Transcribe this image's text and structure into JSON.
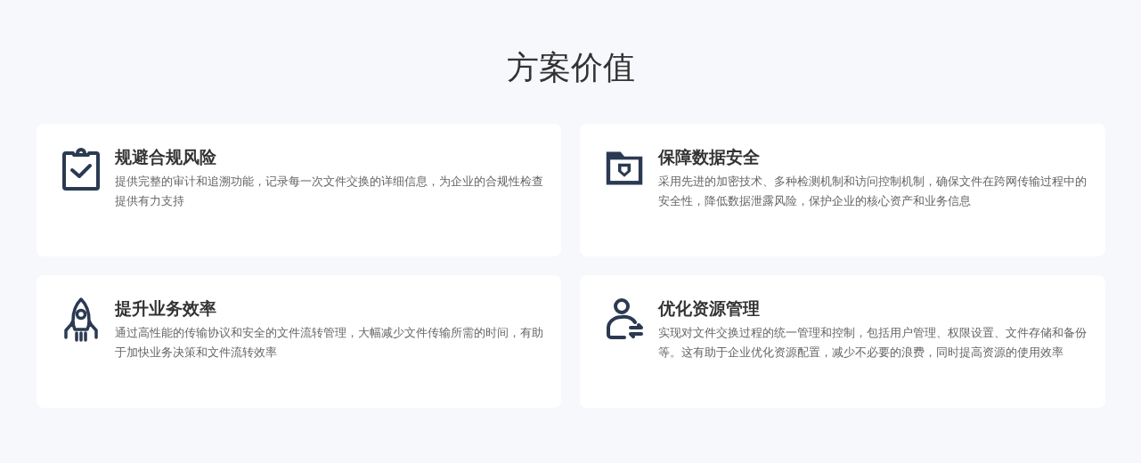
{
  "heading": "方案价值",
  "cards": [
    {
      "title": "规避合规风险",
      "text": "提供完整的审计和追溯功能，记录每一次文件交换的详细信息，为企业的合规性检查提供有力支持"
    },
    {
      "title": "保障数据安全",
      "text": "采用先进的加密技术、多种检测机制和访问控制机制，确保文件在跨网传输过程中的安全性，降低数据泄露风险，保护企业的核心资产和业务信息"
    },
    {
      "title": "提升业务效率",
      "text": "通过高性能的传输协议和安全的文件流转管理，大幅减少文件传输所需的时间，有助于加快业务决策和文件流转效率"
    },
    {
      "title": "优化资源管理",
      "text": "实现对文件交换过程的统一管理和控制，包括用户管理、权限设置、文件存储和备份等。这有助于企业优化资源配置，减少不必要的浪费，同时提高资源的使用效率"
    }
  ]
}
